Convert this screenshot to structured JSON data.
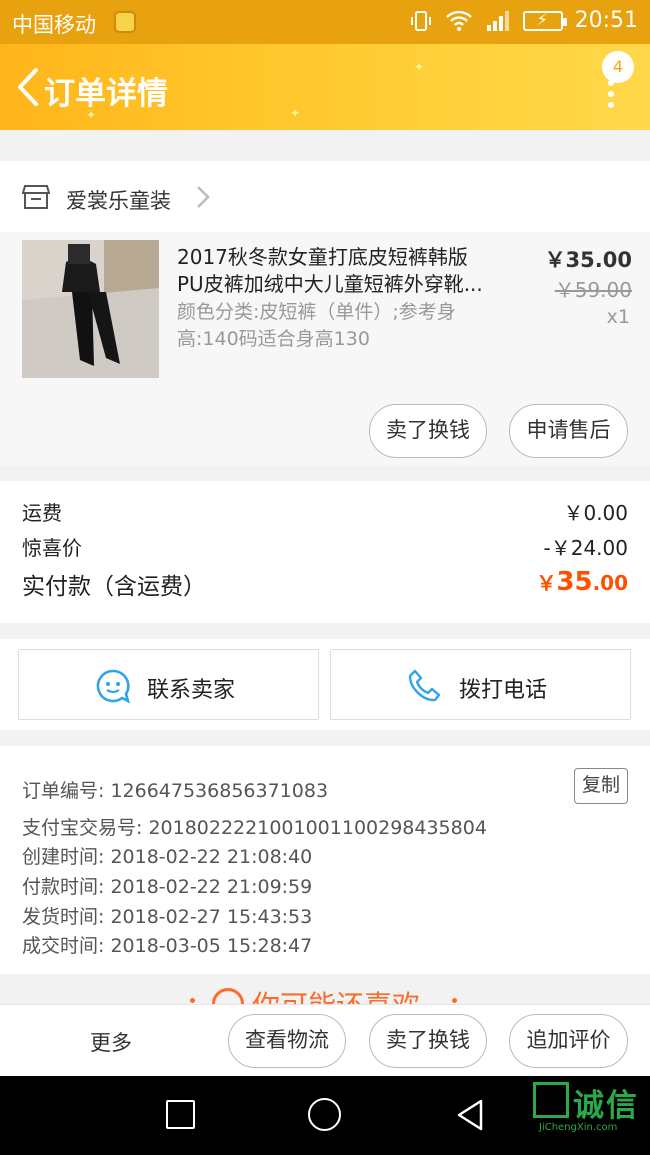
{
  "status_bar": {
    "carrier": "中国移动",
    "time": "20:51"
  },
  "header": {
    "title": "订单详情",
    "badge_count": "4"
  },
  "shop": {
    "name": "爱裳乐童装"
  },
  "product": {
    "title_line1": "2017秋冬款女童打底皮短裤韩版",
    "title_line2": "PU皮裤加绒中大儿童短裤外穿靴...",
    "sku": "颜色分类:皮短裤（单件）;参考身高:140码适合身高130",
    "price": "￥35.00",
    "original_price": "￥59.00",
    "quantity": "x1",
    "buttons": [
      "卖了换钱",
      "申请售后"
    ]
  },
  "totals": {
    "shipping_label": "运费",
    "shipping_value": "￥0.00",
    "discount_label": "惊喜价",
    "discount_value": "-￥24.00",
    "paid_label": "实付款（含运费）",
    "paid_currency": "￥",
    "paid_integer": "35",
    "paid_decimal": ".00"
  },
  "contact": {
    "seller_label": "联系卖家",
    "phone_label": "拨打电话"
  },
  "order_info": {
    "order_no": "订单编号: 1266475368563710​83",
    "copy_label": "复制",
    "alipay_no": "支付宝交易号: 2018022221001001100298435804",
    "created": "创建时间:  2018-02-22 21:08:40",
    "paid": "付款时间:  2018-02-22 21:09:59",
    "shipped": "发货时间:  2018-02-27 15:43:53",
    "completed": "成交时间:  2018-03-05 15:28:47"
  },
  "recommend": {
    "label": "你可能还喜欢"
  },
  "action_bar": {
    "more": "更多",
    "logistics": "查看物流",
    "resell": "卖了换钱",
    "add_review": "追加评价"
  },
  "watermark": {
    "text": "诚信",
    "sub": "JiChengXin.com"
  },
  "colors": {
    "header_start": "#ffb51a",
    "header_end": "#ffd84a",
    "price_accent": "#ff5000",
    "contact_icon": "#2fa4e7"
  }
}
